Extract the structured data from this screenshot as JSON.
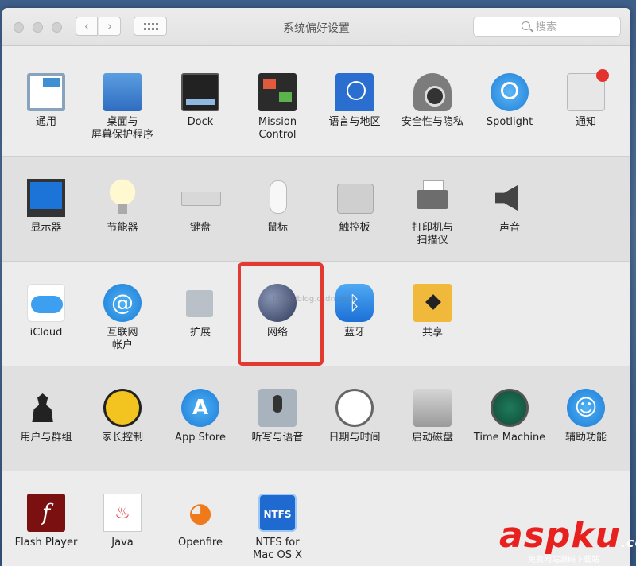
{
  "window": {
    "title": "系统偏好设置",
    "search_placeholder": "搜索"
  },
  "sections": [
    {
      "items": [
        {
          "name": "general",
          "label": "通用"
        },
        {
          "name": "desktop-screensaver",
          "label": "桌面与\n屏幕保护程序"
        },
        {
          "name": "dock",
          "label": "Dock"
        },
        {
          "name": "mission-control",
          "label": "Mission\nControl"
        },
        {
          "name": "language-region",
          "label": "语言与地区"
        },
        {
          "name": "security-privacy",
          "label": "安全性与隐私"
        },
        {
          "name": "spotlight",
          "label": "Spotlight"
        },
        {
          "name": "notifications",
          "label": "通知"
        }
      ]
    },
    {
      "items": [
        {
          "name": "displays",
          "label": "显示器"
        },
        {
          "name": "energy-saver",
          "label": "节能器"
        },
        {
          "name": "keyboard",
          "label": "键盘"
        },
        {
          "name": "mouse",
          "label": "鼠标"
        },
        {
          "name": "trackpad",
          "label": "触控板"
        },
        {
          "name": "printers-scanners",
          "label": "打印机与\n扫描仪"
        },
        {
          "name": "sound",
          "label": "声音"
        }
      ]
    },
    {
      "items": [
        {
          "name": "icloud",
          "label": "iCloud"
        },
        {
          "name": "internet-accounts",
          "label": "互联网\n帐户"
        },
        {
          "name": "extensions",
          "label": "扩展"
        },
        {
          "name": "network",
          "label": "网络"
        },
        {
          "name": "bluetooth",
          "label": "蓝牙"
        },
        {
          "name": "sharing",
          "label": "共享"
        }
      ]
    },
    {
      "items": [
        {
          "name": "users-groups",
          "label": "用户与群组"
        },
        {
          "name": "parental-controls",
          "label": "家长控制"
        },
        {
          "name": "app-store",
          "label": "App Store"
        },
        {
          "name": "dictation-speech",
          "label": "听写与语音"
        },
        {
          "name": "date-time",
          "label": "日期与时间"
        },
        {
          "name": "startup-disk",
          "label": "启动磁盘"
        },
        {
          "name": "time-machine",
          "label": "Time Machine"
        },
        {
          "name": "accessibility",
          "label": "辅助功能"
        }
      ]
    },
    {
      "items": [
        {
          "name": "flash-player",
          "label": "Flash Player"
        },
        {
          "name": "java",
          "label": "Java"
        },
        {
          "name": "openfire",
          "label": "Openfire"
        },
        {
          "name": "ntfs-for-mac",
          "label": "NTFS for\nMac OS X"
        }
      ]
    }
  ],
  "icon_glyphs": {
    "accounts": "@",
    "bluetooth": "ᛒ",
    "app_store": "A",
    "accessibility": "☺",
    "flash": "f",
    "java": "♨",
    "openfire": "◕",
    "ntfs": "NTFS"
  },
  "annotation": {
    "highlight_color": "#e23a31",
    "highlighted_item": "network"
  },
  "watermark": {
    "faint_text": "http://blog.csdn.net/",
    "brand": "aspku",
    "brand_suffix": ".com",
    "subtitle": "免费网站源码下载站"
  },
  "colors": {
    "brand": "#e8211f"
  }
}
